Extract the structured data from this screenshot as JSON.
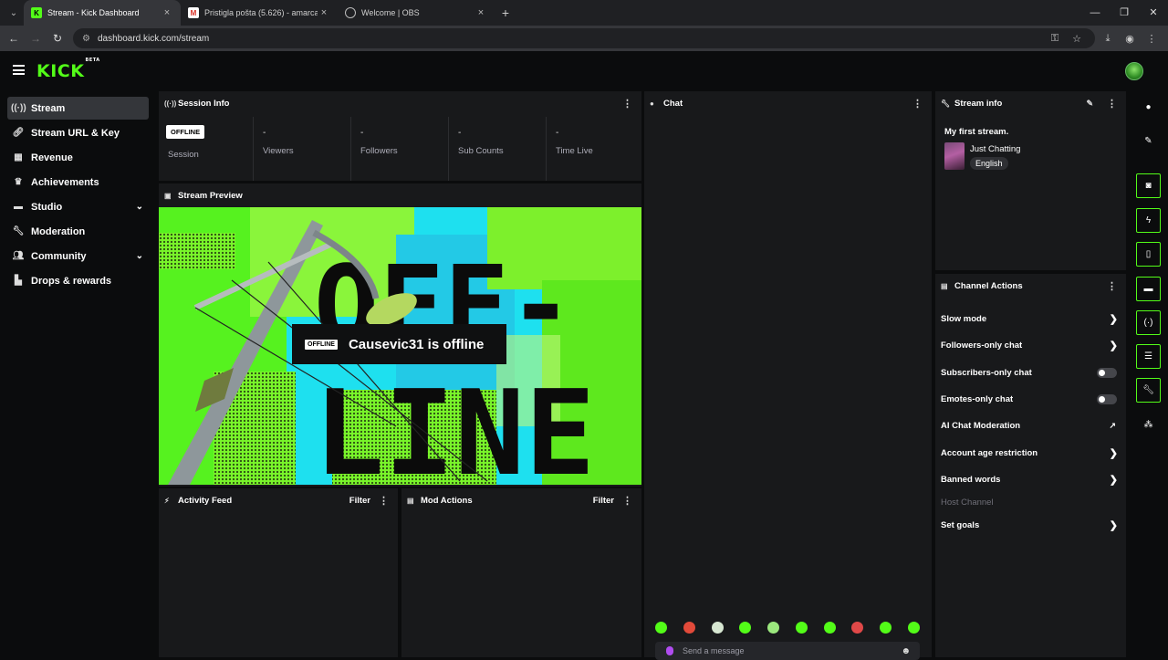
{
  "browser": {
    "tabs": [
      {
        "title": "Stream - Kick Dashboard",
        "favicon": "kick-favicon",
        "active": true
      },
      {
        "title": "Pristigla pošta (5.626) - amarca",
        "favicon": "gmail-favicon",
        "active": false
      },
      {
        "title": "Welcome | OBS",
        "favicon": "globe-favicon",
        "active": false
      }
    ],
    "new_tab": "+",
    "url": "dashboard.kick.com/stream"
  },
  "brand": {
    "logo": "KICK",
    "logo_badge": "BETA",
    "accent": "#53fc18"
  },
  "sidebar": {
    "items": [
      {
        "label": "Stream",
        "icon": "broadcast-icon",
        "active": true
      },
      {
        "label": "Stream URL & Key",
        "icon": "link-icon"
      },
      {
        "label": "Revenue",
        "icon": "revenue-icon"
      },
      {
        "label": "Achievements",
        "icon": "trophy-icon"
      },
      {
        "label": "Studio",
        "icon": "studio-icon",
        "expandable": true
      },
      {
        "label": "Moderation",
        "icon": "wrench-icon"
      },
      {
        "label": "Community",
        "icon": "community-icon",
        "expandable": true
      },
      {
        "label": "Drops & rewards",
        "icon": "gift-icon"
      }
    ]
  },
  "session_info": {
    "title": "Session Info",
    "status_badge": "OFFLINE",
    "cells": [
      {
        "label": "Session",
        "value": ""
      },
      {
        "label": "Viewers",
        "value": "-"
      },
      {
        "label": "Followers",
        "value": "-"
      },
      {
        "label": "Sub Counts",
        "value": "-"
      },
      {
        "label": "Time Live",
        "value": "-"
      }
    ]
  },
  "stream_preview": {
    "title": "Stream Preview",
    "badge": "OFFLINE",
    "message": "Causevic31 is offline",
    "art_text_1": "OFF-",
    "art_text_2": "LINE"
  },
  "activity_feed": {
    "title": "Activity Feed",
    "filter": "Filter"
  },
  "mod_actions": {
    "title": "Mod Actions",
    "filter": "Filter"
  },
  "chat": {
    "title": "Chat",
    "placeholder": "Send a message",
    "emote_count": 10
  },
  "stream_info": {
    "title": "Stream info",
    "stream_title": "My first stream.",
    "category": "Just Chatting",
    "language": "English"
  },
  "channel_actions": {
    "title": "Channel Actions",
    "items": [
      {
        "label": "Slow mode",
        "control": "arrow"
      },
      {
        "label": "Followers-only chat",
        "control": "arrow"
      },
      {
        "label": "Subscribers-only chat",
        "control": "toggle"
      },
      {
        "label": "Emotes-only chat",
        "control": "toggle"
      },
      {
        "label": "AI Chat Moderation",
        "control": "external"
      },
      {
        "label": "Account age restriction",
        "control": "arrow"
      },
      {
        "label": "Banned words",
        "control": "arrow"
      },
      {
        "label": "Host Channel",
        "control": "none",
        "disabled": true
      },
      {
        "label": "Set goals",
        "control": "arrow"
      }
    ]
  },
  "right_rail": {
    "buttons": [
      "info-icon",
      "pencil-icon",
      "capture-icon",
      "bolt-icon",
      "clipboard-icon",
      "chat-bubble-icon",
      "broadcast-icon",
      "layout-icon",
      "wrench-icon",
      "share-icon"
    ]
  }
}
